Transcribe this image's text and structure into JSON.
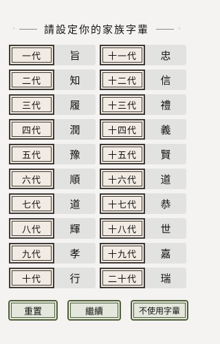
{
  "title": "請設定你的家族字輩",
  "title_decoration": "◦",
  "generations": [
    {
      "left": {
        "label": "一代",
        "char": "旨"
      },
      "right": {
        "label": "十一代",
        "char": "忠"
      }
    },
    {
      "left": {
        "label": "二代",
        "char": "知"
      },
      "right": {
        "label": "十二代",
        "char": "信"
      }
    },
    {
      "left": {
        "label": "三代",
        "char": "履"
      },
      "right": {
        "label": "十三代",
        "char": "禮"
      }
    },
    {
      "left": {
        "label": "四代",
        "char": "潤"
      },
      "right": {
        "label": "十四代",
        "char": "義"
      }
    },
    {
      "left": {
        "label": "五代",
        "char": "豫"
      },
      "right": {
        "label": "十五代",
        "char": "賢"
      }
    },
    {
      "left": {
        "label": "六代",
        "char": "順"
      },
      "right": {
        "label": "十六代",
        "char": "道"
      }
    },
    {
      "left": {
        "label": "七代",
        "char": "道"
      },
      "right": {
        "label": "十七代",
        "char": "恭"
      }
    },
    {
      "left": {
        "label": "八代",
        "char": "輝"
      },
      "right": {
        "label": "十八代",
        "char": "世"
      }
    },
    {
      "left": {
        "label": "九代",
        "char": "孝"
      },
      "right": {
        "label": "十九代",
        "char": "嘉"
      }
    },
    {
      "left": {
        "label": "十代",
        "char": "行"
      },
      "right": {
        "label": "二十代",
        "char": "瑞"
      }
    }
  ],
  "buttons": {
    "reset": "重置",
    "continue": "繼續",
    "skip": "不使用字輩"
  },
  "colors": {
    "background": "#f4f3f1",
    "badge_border": "#3f3a36",
    "button_border": "#4f5f3b"
  }
}
